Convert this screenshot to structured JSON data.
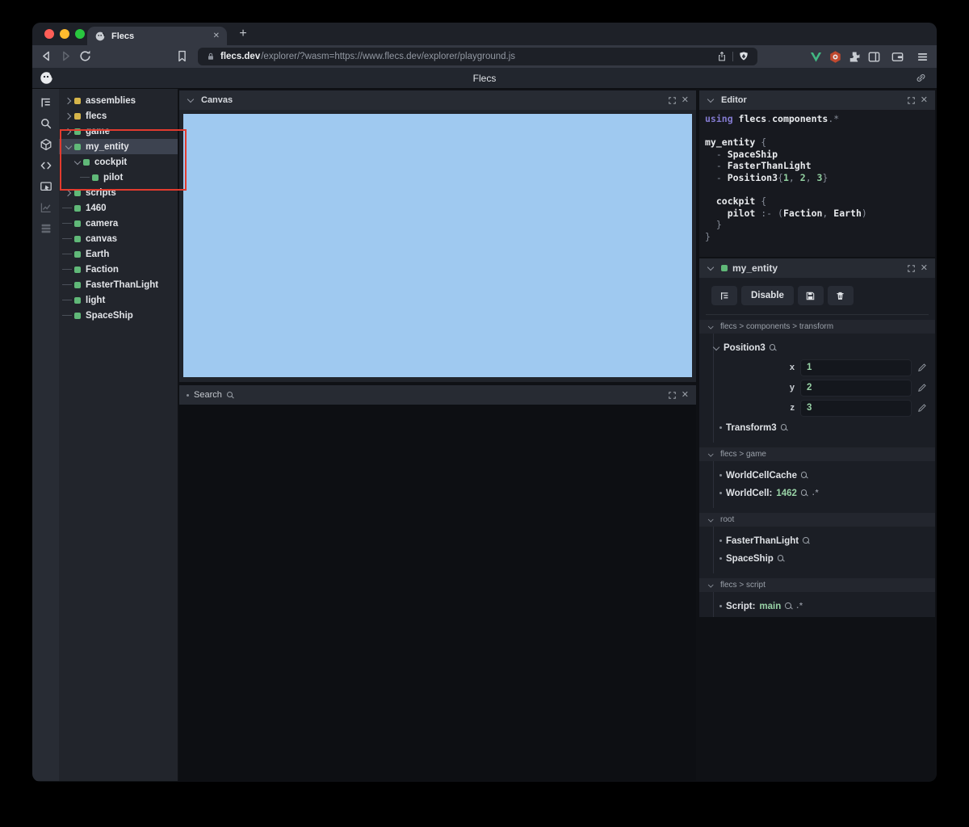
{
  "ui": {
    "close_glyph": "✕",
    "new_tab_glyph": "+"
  },
  "colors": {
    "canvas_blue": "#9fc9f0",
    "entity_green": "#60b878",
    "module_yellow": "#d6b54a",
    "value_green": "#98d3a6",
    "keyword_purple": "#837ad0",
    "annotation_red": "#e23b2e",
    "traffic_red": "#ff5e57",
    "traffic_yellow": "#febb2e",
    "traffic_green": "#29c73f",
    "vue_green": "#42b883"
  },
  "browser": {
    "tab": {
      "title": "Flecs",
      "favicon": "flecs-logo"
    },
    "toolbar": {
      "url_host": "flecs.dev",
      "url_path": "/explorer/?wasm=https://www.flecs.dev/explorer/playground.js",
      "nav_icons": [
        "back-icon",
        "forward-icon",
        "reload-icon",
        "bookmark-icon"
      ],
      "urlbar_icons": [
        "lock-icon",
        "share-icon",
        "brave-shield-icon"
      ],
      "right_icons": [
        "vue-devtools-icon",
        "extension-hex-icon",
        "puzzle-icon",
        "sidebar-toggle-icon",
        "wallet-icon",
        "menu-icon"
      ]
    }
  },
  "app_header": {
    "title": "Flecs"
  },
  "sidebar_icons": [
    "tree-view-icon",
    "search-icon",
    "cube-icon",
    "code-icon",
    "inspect-window-icon",
    "chart-icon",
    "rows-icon"
  ],
  "tree": {
    "items": [
      {
        "label": "assemblies",
        "square": "yellow",
        "state": "collapsed",
        "depth": 0
      },
      {
        "label": "flecs",
        "square": "yellow",
        "state": "collapsed",
        "depth": 0
      },
      {
        "label": "game",
        "square": "green",
        "state": "collapsed",
        "depth": 0
      },
      {
        "label": "my_entity",
        "square": "green",
        "state": "expanded",
        "depth": 0,
        "selected": true
      },
      {
        "label": "cockpit",
        "square": "green",
        "state": "expanded",
        "depth": 1
      },
      {
        "label": "pilot",
        "square": "green",
        "state": "leaf",
        "depth": 2
      },
      {
        "label": "scripts",
        "square": "green",
        "state": "collapsed",
        "depth": 0
      },
      {
        "label": "1460",
        "square": "green",
        "state": "leaf",
        "depth": 0
      },
      {
        "label": "camera",
        "square": "green",
        "state": "leaf",
        "depth": 0
      },
      {
        "label": "canvas",
        "square": "green",
        "state": "leaf",
        "depth": 0
      },
      {
        "label": "Earth",
        "square": "green",
        "state": "leaf",
        "depth": 0
      },
      {
        "label": "Faction",
        "square": "green",
        "state": "leaf",
        "depth": 0
      },
      {
        "label": "FasterThanLight",
        "square": "green",
        "state": "leaf",
        "depth": 0
      },
      {
        "label": "light",
        "square": "green",
        "state": "leaf",
        "depth": 0
      },
      {
        "label": "SpaceShip",
        "square": "green",
        "state": "leaf",
        "depth": 0
      }
    ]
  },
  "canvas_panel": {
    "title": "Canvas"
  },
  "search_panel": {
    "title": "Search"
  },
  "editor_panel": {
    "title": "Editor",
    "code": [
      [
        [
          "using ",
          "kw"
        ],
        [
          "flecs",
          "id"
        ],
        [
          ".",
          "p"
        ],
        [
          "components",
          "id"
        ],
        [
          ".*",
          "p"
        ]
      ],
      [],
      [
        [
          "my_entity ",
          "id"
        ],
        [
          "{",
          "p"
        ]
      ],
      [
        [
          "  - ",
          "p"
        ],
        [
          "SpaceShip",
          "id"
        ]
      ],
      [
        [
          "  - ",
          "p"
        ],
        [
          "FasterThanLight",
          "id"
        ]
      ],
      [
        [
          "  - ",
          "p"
        ],
        [
          "Position3",
          "id"
        ],
        [
          "{",
          "p"
        ],
        [
          "1",
          "num"
        ],
        [
          ", ",
          "p"
        ],
        [
          "2",
          "num"
        ],
        [
          ", ",
          "p"
        ],
        [
          "3",
          "num"
        ],
        [
          "}",
          "p"
        ]
      ],
      [],
      [
        [
          "  ",
          "p"
        ],
        [
          "cockpit ",
          "id"
        ],
        [
          "{",
          "p"
        ]
      ],
      [
        [
          "    ",
          "p"
        ],
        [
          "pilot ",
          "id"
        ],
        [
          ":- (",
          "p"
        ],
        [
          "Faction",
          "id"
        ],
        [
          ", ",
          "p"
        ],
        [
          "Earth",
          "id"
        ],
        [
          ")",
          "p"
        ]
      ],
      [
        [
          "  }",
          "p"
        ]
      ],
      [
        [
          "}",
          "p"
        ]
      ]
    ]
  },
  "inspector_panel": {
    "title": "my_entity",
    "buttons": [
      {
        "name": "tree-button",
        "icon": "tree-view-icon"
      },
      {
        "name": "disable-button",
        "label": "Disable"
      },
      {
        "name": "save-button",
        "icon": "save-icon"
      },
      {
        "name": "delete-button",
        "icon": "trash-icon"
      }
    ],
    "sections": [
      {
        "breadcrumb": "flecs > components > transform",
        "items": [
          {
            "kind": "expanded",
            "name": "Position3",
            "fields": [
              {
                "label": "x",
                "value": "1"
              },
              {
                "label": "y",
                "value": "2"
              },
              {
                "label": "z",
                "value": "3"
              }
            ]
          },
          {
            "kind": "bullet",
            "name": "Transform3"
          }
        ]
      },
      {
        "breadcrumb": "flecs > game",
        "items": [
          {
            "kind": "bullet",
            "name": "WorldCellCache"
          },
          {
            "kind": "bullet",
            "name": "WorldCell:",
            "value": "1462",
            "pair": true
          }
        ]
      },
      {
        "breadcrumb": "root",
        "items": [
          {
            "kind": "bullet",
            "name": "FasterThanLight"
          },
          {
            "kind": "bullet",
            "name": "SpaceShip"
          }
        ]
      },
      {
        "breadcrumb": "flecs > script",
        "items": [
          {
            "kind": "bullet",
            "name": "Script:",
            "value": "main",
            "pair": true
          }
        ]
      }
    ]
  },
  "annotation": {
    "type": "red-highlight-box",
    "around": "my_entity subtree"
  }
}
